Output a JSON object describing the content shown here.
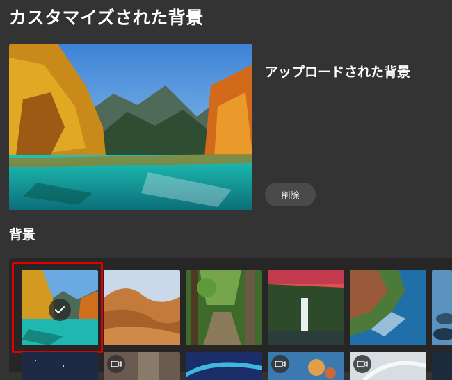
{
  "page": {
    "title": "カスタマイズされた背景"
  },
  "upload": {
    "title": "アップロードされた背景",
    "delete_label": "削除"
  },
  "backgrounds": {
    "title": "背景",
    "selected_index": 0,
    "row1": [
      {
        "name": "autumn-lake",
        "selected": true
      },
      {
        "name": "desert-dunes"
      },
      {
        "name": "forest-path"
      },
      {
        "name": "waterfall-sunset"
      },
      {
        "name": "coastal-cliffs"
      },
      {
        "name": "blue-pebbles"
      }
    ],
    "row2": [
      {
        "name": "night-sky"
      },
      {
        "name": "indoor-room",
        "video": true
      },
      {
        "name": "aurora"
      },
      {
        "name": "coral-reef",
        "video": true
      },
      {
        "name": "white-waves",
        "video": true
      },
      {
        "name": "dark-blue"
      }
    ]
  },
  "icons": {
    "check": "check-icon",
    "video": "video-camera-icon"
  }
}
